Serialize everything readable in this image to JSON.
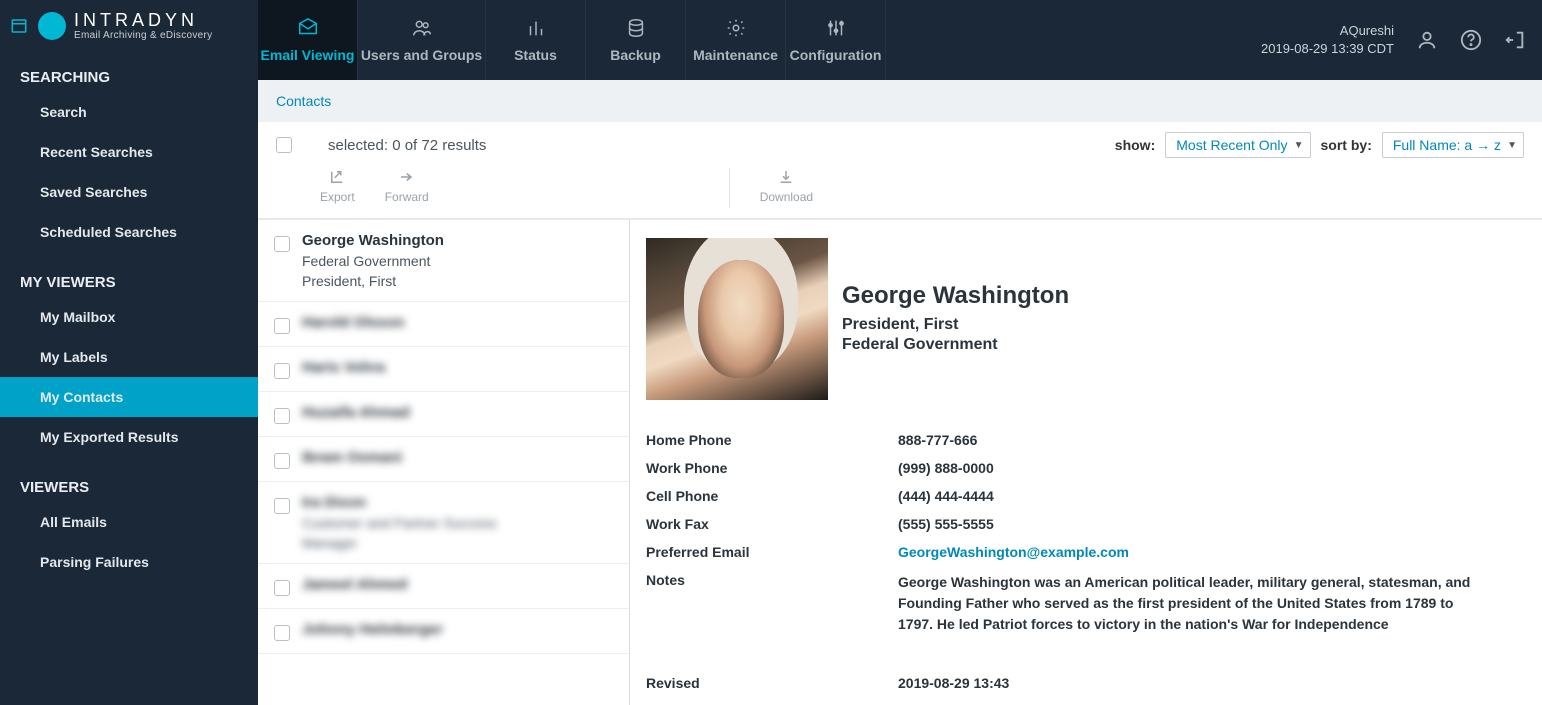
{
  "brand": {
    "name": "INTRADYN",
    "tagline": "Email Archiving & eDiscovery"
  },
  "topnav": {
    "items": [
      {
        "label": "Email Viewing",
        "active": true
      },
      {
        "label": "Users and Groups"
      },
      {
        "label": "Status"
      },
      {
        "label": "Backup"
      },
      {
        "label": "Maintenance"
      },
      {
        "label": "Configuration"
      }
    ],
    "user": "AQureshi",
    "datetime": "2019-08-29 13:39 CDT"
  },
  "sidebar": {
    "sections": [
      {
        "title": "SEARCHING",
        "items": [
          "Search",
          "Recent Searches",
          "Saved Searches",
          "Scheduled Searches"
        ]
      },
      {
        "title": "MY VIEWERS",
        "items": [
          "My Mailbox",
          "My Labels",
          "My Contacts",
          "My Exported Results"
        ],
        "activeIndex": 2
      },
      {
        "title": "VIEWERS",
        "items": [
          "All Emails",
          "Parsing Failures"
        ]
      }
    ]
  },
  "crumb": "Contacts",
  "toolbar": {
    "selected": "selected: 0 of 72 results",
    "showLbl": "show:",
    "showVal": "Most Recent Only",
    "sortLbl": "sort by:",
    "sortVal": "Full Name: a → z",
    "actions": {
      "export": "Export",
      "forward": "Forward",
      "download": "Download"
    }
  },
  "list": [
    {
      "name": "George Washington",
      "org": "Federal Government",
      "title": "President, First"
    },
    {
      "name": "Harold Olsson",
      "blur": true
    },
    {
      "name": "Haris Vohra",
      "blur": true
    },
    {
      "name": "Huzaifa Ahmad",
      "blur": true
    },
    {
      "name": "Ibram Osmani",
      "blur": true
    },
    {
      "name": "Ira Dixon",
      "org": "Customer and Partner Success",
      "title": "Manager",
      "blur": true
    },
    {
      "name": "Jameel Ahmed",
      "blur": true
    },
    {
      "name": "Johnny Helmberger",
      "blur": true
    }
  ],
  "detail": {
    "name": "George Washington",
    "title": "President, First",
    "org": "Federal Government",
    "fields": [
      {
        "k": "Home Phone",
        "v": "888-777-666"
      },
      {
        "k": "Work Phone",
        "v": "(999) 888-0000"
      },
      {
        "k": "Cell Phone",
        "v": "(444) 444-4444"
      },
      {
        "k": "Work Fax",
        "v": "(555) 555-5555"
      },
      {
        "k": "Preferred Email",
        "v": "GeorgeWashington@example.com",
        "link": true
      },
      {
        "k": "Notes",
        "v": "George Washington was an American political leader, military general, statesman, and Founding Father who served as the first president of the United States from 1789 to 1797. He led Patriot forces to victory in the nation's War for Independence",
        "notes": true
      }
    ],
    "revisedK": "Revised",
    "revisedV": "2019-08-29 13:43"
  }
}
